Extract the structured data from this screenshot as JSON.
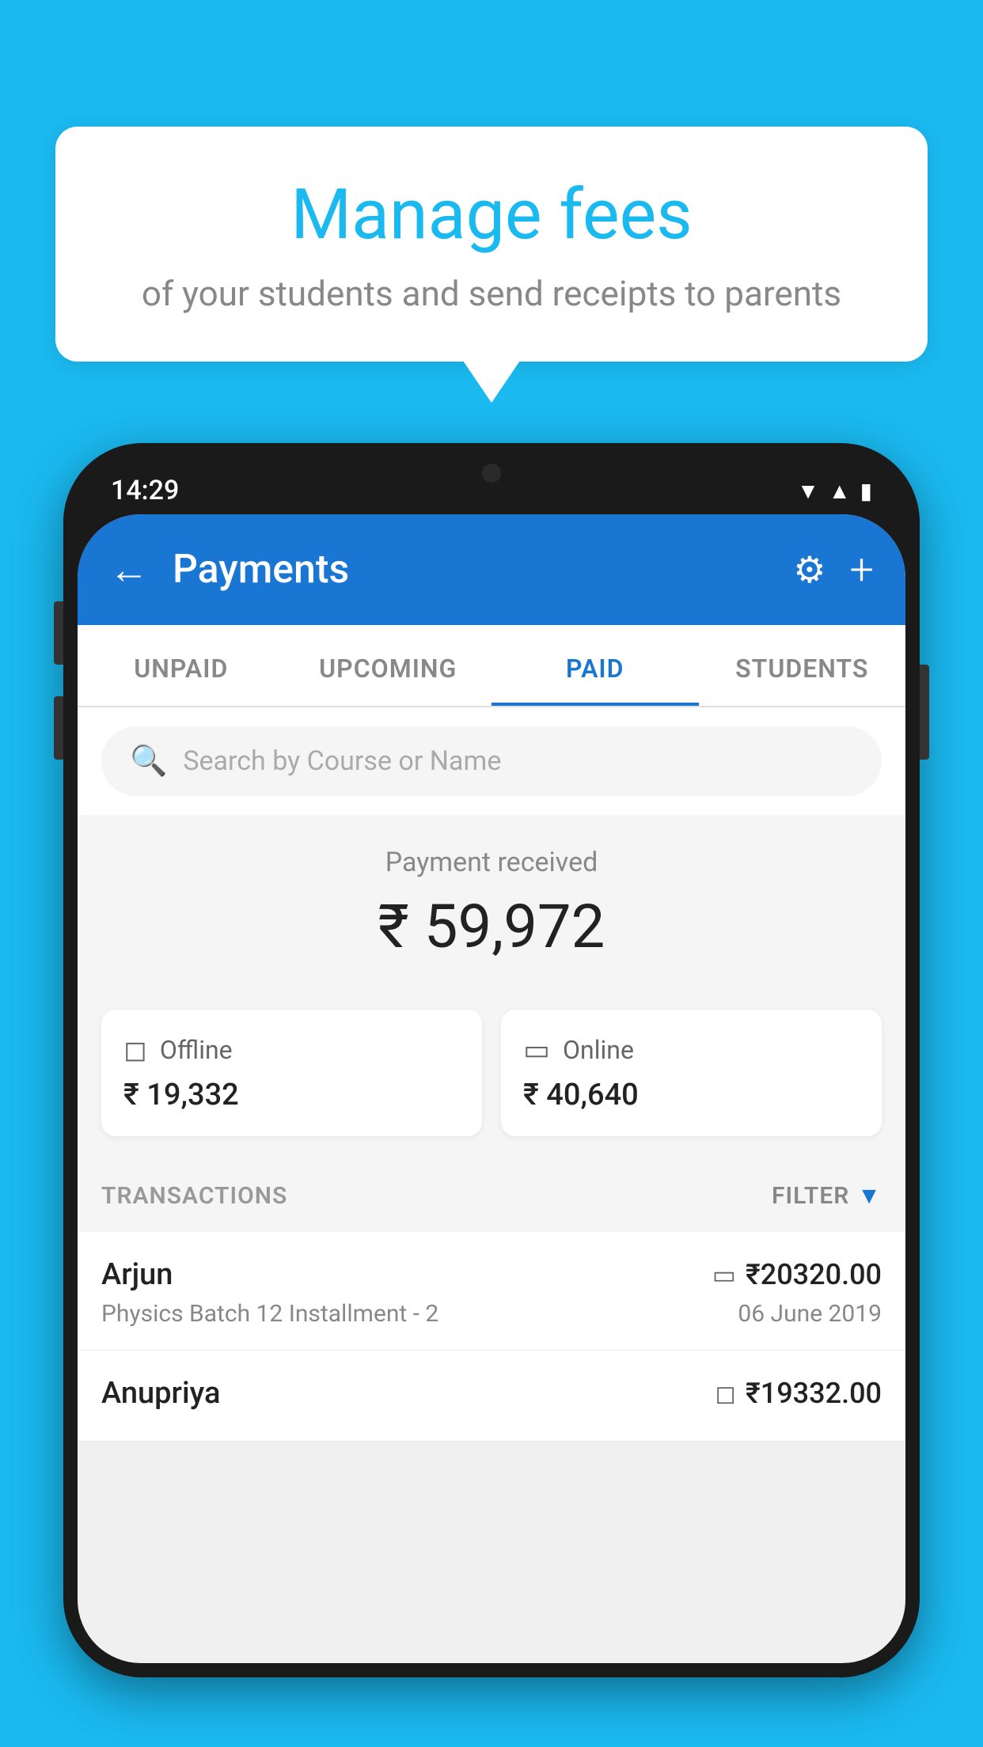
{
  "background_color": "#1ab9f0",
  "speech_bubble": {
    "title": "Manage fees",
    "subtitle": "of your students and send receipts to parents"
  },
  "status_bar": {
    "time": "14:29",
    "icons": [
      "wifi",
      "signal",
      "battery"
    ]
  },
  "header": {
    "title": "Payments",
    "back_icon": "←",
    "gear_icon": "⚙",
    "plus_icon": "+"
  },
  "tabs": [
    {
      "label": "UNPAID",
      "active": false
    },
    {
      "label": "UPCOMING",
      "active": false
    },
    {
      "label": "PAID",
      "active": true
    },
    {
      "label": "STUDENTS",
      "active": false
    }
  ],
  "search": {
    "placeholder": "Search by Course or Name"
  },
  "payment_summary": {
    "label": "Payment received",
    "amount": "₹ 59,972",
    "offline": {
      "icon": "💳",
      "label": "Offline",
      "amount": "₹ 19,332"
    },
    "online": {
      "icon": "💳",
      "label": "Online",
      "amount": "₹ 40,640"
    }
  },
  "transactions": {
    "section_label": "TRANSACTIONS",
    "filter_label": "FILTER",
    "items": [
      {
        "name": "Arjun",
        "course": "Physics Batch 12 Installment - 2",
        "amount": "₹20320.00",
        "date": "06 June 2019",
        "payment_type": "online"
      },
      {
        "name": "Anupriya",
        "course": "",
        "amount": "₹19332.00",
        "date": "",
        "payment_type": "offline"
      }
    ]
  }
}
